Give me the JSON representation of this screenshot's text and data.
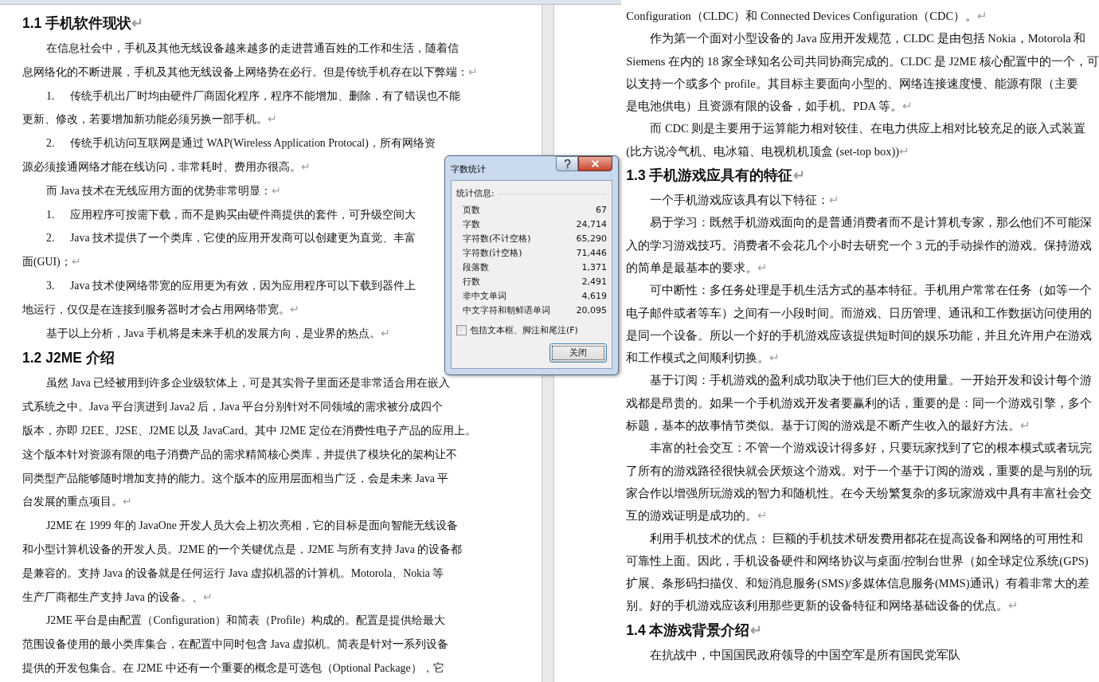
{
  "left_page": {
    "paragraphs": [
      {
        "kind": "heading",
        "lines": [
          "1.1  手机软件现状"
        ],
        "end_mark": "↵"
      },
      {
        "kind": "body",
        "lines": [
          "在信息社会中，手机及其他无线设备越来越多的走进普通百姓的工作和生活，随着信",
          "息网络化的不断进展，手机及其他无线设备上网络势在必行。但是传统手机存在以下弊端："
        ],
        "end_mark": "↵"
      },
      {
        "kind": "list",
        "number": "1.",
        "lines": [
          "传统手机出厂时均由硬件厂商固化程序，程序不能增加、删除，有了错误也不能",
          "更新、修改，若要增加新功能必须另换一部手机。"
        ],
        "end_mark": "↵"
      },
      {
        "kind": "list",
        "number": "2.",
        "lines": [
          "传统手机访问互联网是通过 WAP(Wireless Application Protocal)，所有网络资",
          "源必须接通网络才能在线访问，非常耗时、费用亦很高。"
        ],
        "end_mark": "↵"
      },
      {
        "kind": "body",
        "lines": [
          "而 Java 技术在无线应用方面的优势非常明显："
        ],
        "end_mark": "↵"
      },
      {
        "kind": "list",
        "number": "1.",
        "lines": [
          "应用程序可按需下载，而不是购买由硬件商提供的套件，可升级空间大"
        ]
      },
      {
        "kind": "list",
        "number": "2.",
        "lines": [
          "Java 技术提供了一个类库，它使的应用开发商可以创建更为直觉、丰富",
          "面(GUI)；"
        ],
        "end_mark": "↵"
      },
      {
        "kind": "list",
        "number": "3.",
        "lines": [
          "Java 技术使网络带宽的应用更为有效，因为应用程序可以下载到器件上",
          "地运行，仅仅是在连接到服务器时才会占用网络带宽。"
        ],
        "end_mark": "↵"
      },
      {
        "kind": "body",
        "lines": [
          "基于以上分析，Java 手机将是未来手机的发展方向，是业界的热点。"
        ],
        "end_mark": "↵"
      },
      {
        "kind": "heading",
        "lines": [
          "1.2  J2ME 介绍"
        ]
      },
      {
        "kind": "body",
        "lines": [
          "虽然 Java 已经被用到许多企业级软体上，可是其实骨子里面还是非常适合用在嵌入",
          "式系统之中。Java 平台演进到 Java2 后，Java 平台分别针对不同领域的需求被分成四个",
          "版本，亦即 J2EE、J2SE、J2ME 以及 JavaCard。其中 J2ME 定位在消费性电子产品的应用上。",
          "这个版本针对资源有限的电子消费产品的需求精简核心类库，并提供了模块化的架构让不",
          "同类型产品能够随时增加支持的能力。这个版本的应用层面相当广泛，会是未来 Java 平",
          "台发展的重点项目。"
        ],
        "end_mark": "↵"
      },
      {
        "kind": "body",
        "lines": [
          "J2ME 在 1999 年的 JavaOne 开发人员大会上初次亮相，它的目标是面向智能无线设备",
          "和小型计算机设备的开发人员。J2ME 的一个关键优点是，J2ME 与所有支持 Java 的设备都",
          "是兼容的。支持 Java 的设备就是任何运行 Java 虚拟机器的计算机。Motorola、Nokia 等",
          "生产厂商都生产支持 Java 的设备。、"
        ],
        "end_mark": "↵"
      },
      {
        "kind": "body",
        "lines": [
          "J2ME 平台是由配置（Configuration）和简表（Profile）构成的。配置是提供给最大",
          "范围设备使用的最小类库集合，在配置中同时包含 Java 虚拟机。简表是针对一系列设备",
          "提供的开发包集合。在 J2ME 中还有一个重要的概念是可选包（Optional Package），它"
        ]
      }
    ]
  },
  "right_page": {
    "paragraphs": [
      {
        "kind": "continuation",
        "lines": [
          "Configuration（CLDC）和 Connected Devices Configuration（CDC）。"
        ],
        "end_mark": "↵"
      },
      {
        "kind": "body",
        "lines": [
          "作为第一个面对小型设备的 Java 应用开发规范，CLDC 是由包括 Nokia，Motorola 和",
          "Siemens 在内的 18 家全球知名公司共同协商完成的。CLDC 是 J2ME 核心配置中的一个，可",
          "以支持一个或多个 profile。其目标主要面向小型的、网络连接速度慢、能源有限（主要",
          "是电池供电）且资源有限的设备，如手机、PDA 等。"
        ],
        "end_mark": "↵"
      },
      {
        "kind": "body",
        "lines": [
          "而 CDC 则是主要用于运算能力相对较佳、在电力供应上相对比较充足的嵌入式装置",
          "(比方说冷气机、电冰箱、电视机机顶盒 (set-top box))"
        ],
        "end_mark": "↵"
      },
      {
        "kind": "heading",
        "lines": [
          "1.3  手机游戏应具有的特征"
        ],
        "end_mark": "↵"
      },
      {
        "kind": "body",
        "lines": [
          "一个手机游戏应该具有以下特征："
        ],
        "end_mark": "↵"
      },
      {
        "kind": "body",
        "lines": [
          "易于学习：既然手机游戏面向的是普通消费者而不是计算机专家，那么他们不可能深",
          "入的学习游戏技巧。消费者不会花几个小时去研究一个 3 元的手动操作的游戏。保持游戏",
          "的简单是最基本的要求。"
        ],
        "end_mark": "↵"
      },
      {
        "kind": "body",
        "lines": [
          "可中断性：多任务处理是手机生活方式的基本特征。手机用户常常在任务（如等一个",
          "电子邮件或者等车）之间有一小段时间。而游戏、日历管理、通讯和工作数据访问使用的",
          "是同一个设备。所以一个好的手机游戏应该提供短时间的娱乐功能，并且允许用户在游戏",
          "和工作模式之间顺利切换。"
        ],
        "end_mark": "↵"
      },
      {
        "kind": "body",
        "lines": [
          "基于订阅：手机游戏的盈利成功取决于他们巨大的使用量。一开始开发和设计每个游",
          "戏都是昂贵的。如果一个手机游戏开发者要赢利的话，重要的是：同一个游戏引擎，多个",
          "标题，基本的故事情节类似。基于订阅的游戏是不断产生收入的最好方法。"
        ],
        "end_mark": "↵"
      },
      {
        "kind": "body",
        "lines": [
          "丰富的社会交互：不管一个游戏设计得多好，只要玩家找到了它的根本模式或者玩完",
          "了所有的游戏路径很快就会厌烦这个游戏。对于一个基于订阅的游戏，重要的是与别的玩",
          "家合作以增强所玩游戏的智力和随机性。在今天纷繁复杂的多玩家游戏中具有丰富社会交",
          "互的游戏证明是成功的。"
        ],
        "end_mark": "↵"
      },
      {
        "kind": "body",
        "lines": [
          "利用手机技术的优点： 巨额的手机技术研发费用都花在提高设备和网络的可用性和",
          "可靠性上面。因此，手机设备硬件和网络协议与桌面/控制台世界（如全球定位系统(GPS)",
          "扩展、条形码扫描仪、和短消息服务(SMS)/多媒体信息服务(MMS)通讯）有着非常大的差",
          "别。好的手机游戏应该利用那些更新的设备特征和网络基础设备的优点。"
        ],
        "end_mark": "↵"
      },
      {
        "kind": "heading",
        "lines": [
          "1.4  本游戏背景介绍"
        ],
        "end_mark": "↵"
      },
      {
        "kind": "body",
        "lines": [
          "在抗战中，中国国民政府领导的中国空军是所有国民党军队"
        ]
      }
    ]
  },
  "dialog": {
    "title": "字数统计",
    "group_label": "统计信息:",
    "stats": [
      {
        "label": "页数",
        "value": "67"
      },
      {
        "label": "字数",
        "value": "24,714"
      },
      {
        "label": "字符数(不计空格)",
        "value": "65,290"
      },
      {
        "label": "字符数(计空格)",
        "value": "71,446"
      },
      {
        "label": "段落数",
        "value": "1,371"
      },
      {
        "label": "行数",
        "value": "2,491"
      },
      {
        "label": "非中文单词",
        "value": "4,619"
      },
      {
        "label": "中文字符和朝鲜语单词",
        "value": "20,095"
      }
    ],
    "checkbox": {
      "label": "包括文本框、脚注和尾注(F)",
      "checked": false
    },
    "close_button": "关闭"
  }
}
